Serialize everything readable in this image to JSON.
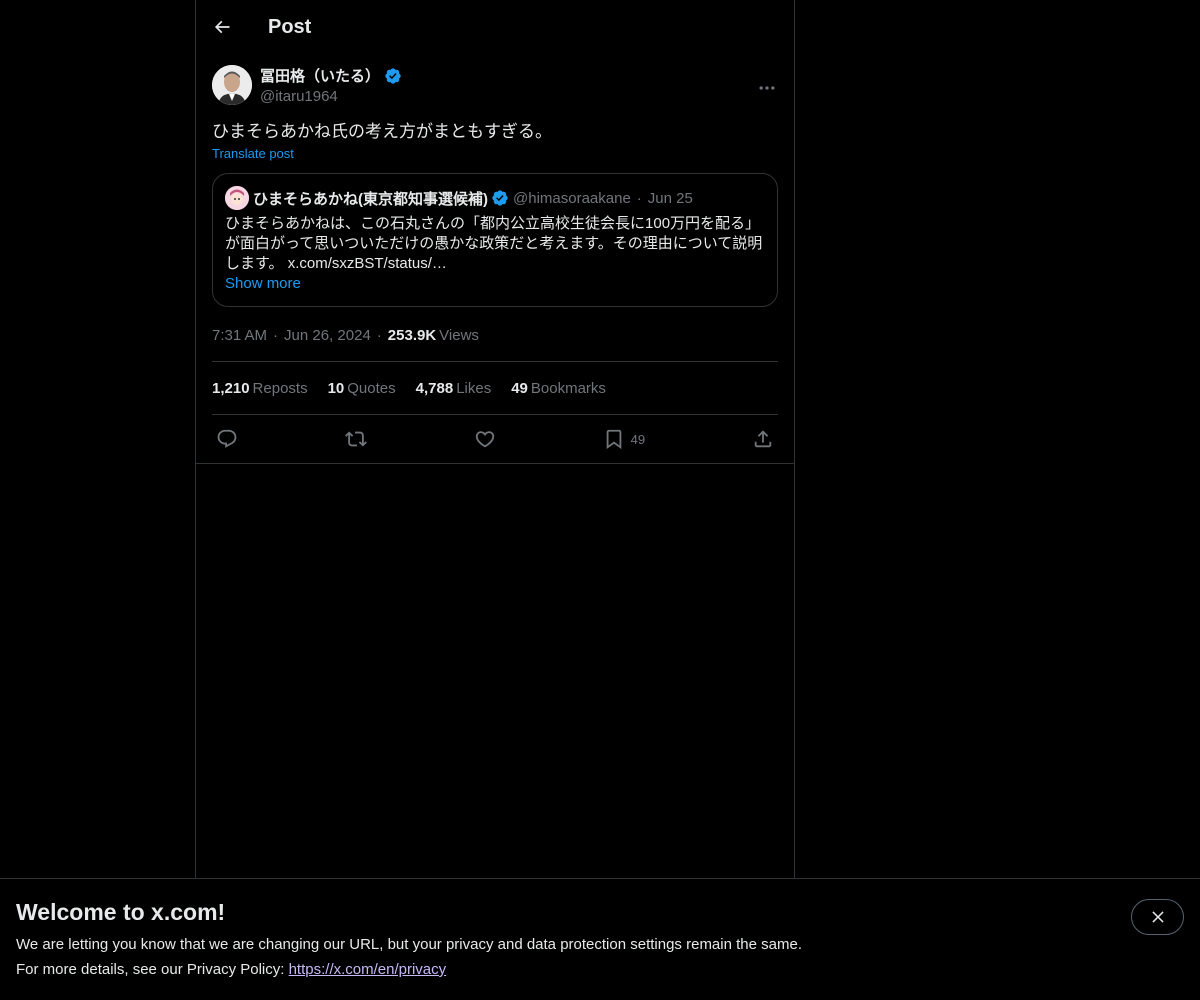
{
  "header": {
    "title": "Post"
  },
  "post": {
    "author_name": "冨田格（いたる）",
    "author_handle": "@itaru1964",
    "text": "ひまそらあかね氏の考え方がまともすぎる。",
    "translate_label": "Translate post",
    "quote": {
      "name": "ひまそらあかね(東京都知事選候補)",
      "handle": "@himasoraakane",
      "date": "Jun 25",
      "text": "ひまそらあかねは、この石丸さんの「都内公立高校生徒会長に100万円を配る」が面白がって思いついただけの愚かな政策だと考えます。その理由について説明します。",
      "link": "x.com/sxzBST/status/…",
      "show_more": "Show more"
    },
    "time": "7:31 AM",
    "date": "Jun 26, 2024",
    "views_count": "253.9K",
    "views_label": "Views",
    "stats": {
      "reposts_count": "1,210",
      "reposts_label": "Reposts",
      "quotes_count": "10",
      "quotes_label": "Quotes",
      "likes_count": "4,788",
      "likes_label": "Likes",
      "bookmarks_count": "49",
      "bookmarks_label": "Bookmarks"
    },
    "actions": {
      "bookmark_count": "49"
    }
  },
  "banner": {
    "title": "Welcome to x.com!",
    "line1": "We are letting you know that we are changing our URL, but your privacy and data protection settings remain the same.",
    "line2_prefix": "For more details, see our Privacy Policy: ",
    "link": "https://x.com/en/privacy"
  },
  "colors": {
    "background": "#000000",
    "text": "#e7e9ea",
    "muted": "#71767b",
    "accent": "#1d9bf0",
    "border": "#2f3336",
    "link_visited": "#c5b8f5"
  },
  "icons": [
    "back-arrow-icon",
    "verified-badge-icon",
    "more-icon",
    "reply-icon",
    "repost-icon",
    "like-icon",
    "bookmark-icon",
    "share-icon",
    "close-icon"
  ]
}
